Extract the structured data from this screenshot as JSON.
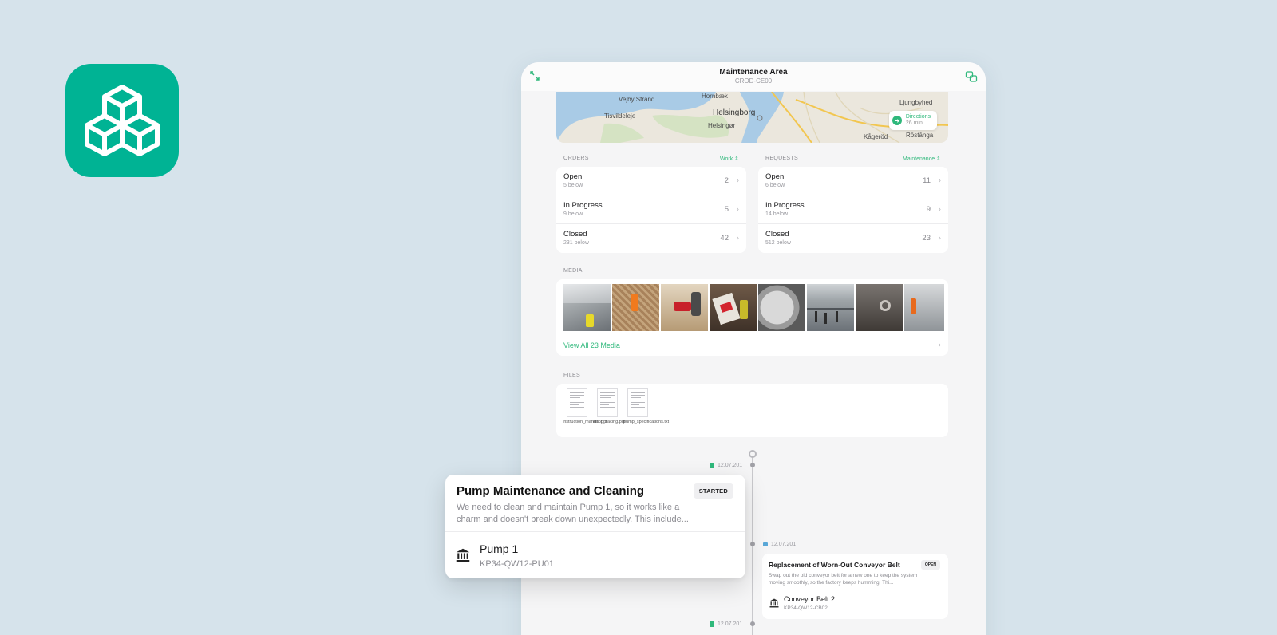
{
  "header": {
    "title": "Maintenance Area",
    "subtitle": "CROD-CE00"
  },
  "map": {
    "labels": [
      "Vejby Strand",
      "Hornbæk",
      "Helsingborg",
      "Tisvildeleje",
      "Helsingør",
      "Ljungbyhed",
      "Kågeröd",
      "Röstånga"
    ],
    "directions_label": "Directions",
    "directions_time": "26 min"
  },
  "orders": {
    "title": "ORDERS",
    "filter": "Work",
    "rows": [
      {
        "label": "Open",
        "sub": "5 below",
        "count": "2"
      },
      {
        "label": "In Progress",
        "sub": "9 below",
        "count": "5"
      },
      {
        "label": "Closed",
        "sub": "231 below",
        "count": "42"
      }
    ]
  },
  "requests": {
    "title": "REQUESTS",
    "filter": "Maintenance",
    "rows": [
      {
        "label": "Open",
        "sub": "6 below",
        "count": "11"
      },
      {
        "label": "In Progress",
        "sub": "14 below",
        "count": "9"
      },
      {
        "label": "Closed",
        "sub": "512 below",
        "count": "23"
      }
    ]
  },
  "media": {
    "title": "MEDIA",
    "view_all": "View All 23 Media"
  },
  "files": {
    "title": "FILES",
    "items": [
      {
        "name": "instruction_manual.pdf"
      },
      {
        "name": "error_tracing.pdf"
      },
      {
        "name": "pump_specifications.txt"
      }
    ]
  },
  "timeline": {
    "dates": [
      "12.07.201",
      "12.07.201",
      "12.07.201"
    ]
  },
  "featured_card": {
    "title": "Pump Maintenance and Cleaning",
    "status": "STARTED",
    "description": "We need to clean and maintain Pump 1, so it works like a charm and doesn't break down unexpectedly. This include...",
    "asset_name": "Pump 1",
    "asset_id": "KP34-QW12-PU01"
  },
  "second_card": {
    "title": "Replacement of Worn-Out Conveyor Belt",
    "status": "OPEN",
    "description": "Swap out the old conveyor belt for a new one to keep the system moving smoothly, so the factory keeps humming. Thi...",
    "asset_name": "Conveyor Belt 2",
    "asset_id": "KP34-QW12-CB02"
  },
  "colors": {
    "accent": "#2fb87b",
    "brand": "#00b394",
    "background": "#d6e3eb"
  },
  "icons": {
    "app": "cubes-icon",
    "expand": "expand-icon",
    "sidebar": "split-view-icon",
    "asset": "building-icon"
  }
}
